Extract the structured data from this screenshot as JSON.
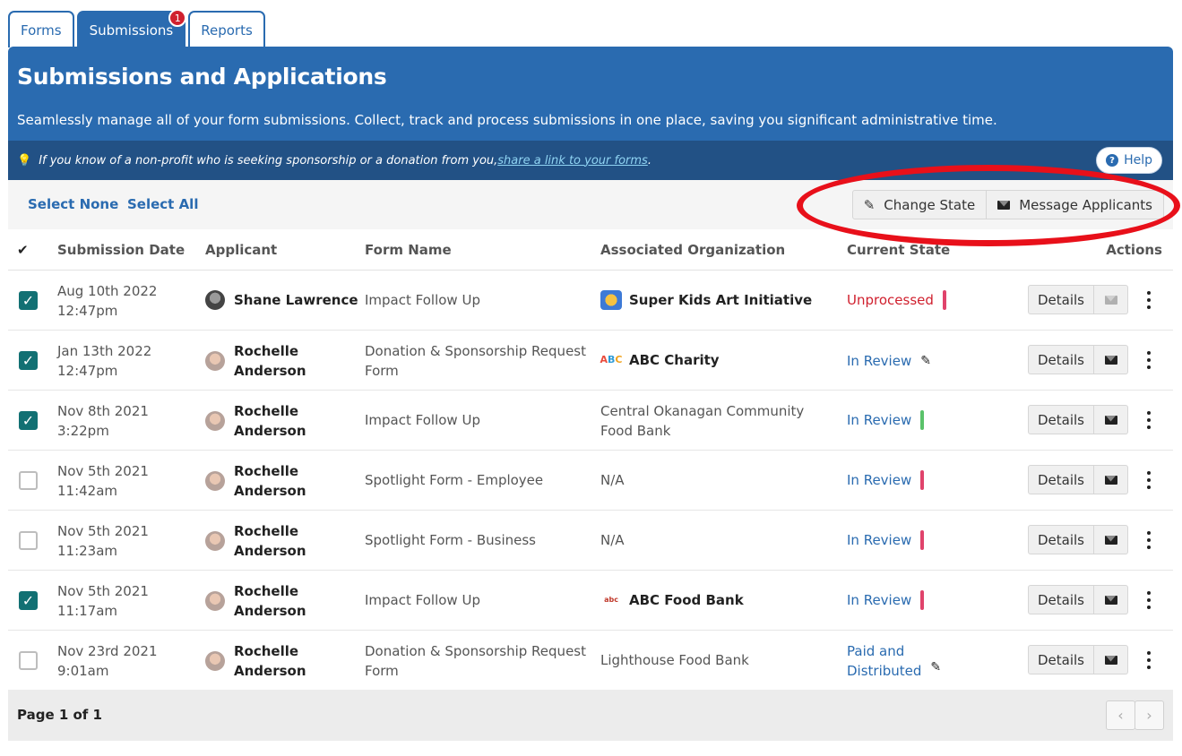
{
  "tabs": [
    {
      "label": "Forms",
      "active": false
    },
    {
      "label": "Submissions",
      "active": true,
      "badge": "1"
    },
    {
      "label": "Reports",
      "active": false
    }
  ],
  "header": {
    "title": "Submissions and Applications",
    "description": "Seamlessly manage all of your form submissions. Collect, track and process submissions in one place, saving you significant administrative time.",
    "tip_text": "If you know of a non-profit who is seeking sponsorship or a donation from you, ",
    "tip_link": "share a link to your forms",
    "tip_end": ".",
    "help_label": "Help"
  },
  "toolbar": {
    "select_none": "Select None",
    "select_all": "Select All",
    "change_state": "Change State",
    "message_applicants": "Message Applicants"
  },
  "table": {
    "headers": {
      "check": "✔",
      "date": "Submission Date",
      "applicant": "Applicant",
      "form": "Form Name",
      "org": "Associated Organization",
      "state": "Current State",
      "actions": "Actions"
    },
    "details_label": "Details",
    "rows": [
      {
        "checked": true,
        "date": "Aug 10th 2022",
        "time": "12:47pm",
        "applicant1": "Shane Lawrence",
        "applicant2": "",
        "form1": "Impact Follow Up",
        "form2": "",
        "org1": "Super Kids Art Initiative",
        "org2": "",
        "state1": "Unprocessed",
        "state2": ""
      },
      {
        "checked": true,
        "date": "Jan 13th 2022",
        "time": "12:47pm",
        "applicant1": "Rochelle",
        "applicant2": "Anderson",
        "form1": "Donation & Sponsorship Request",
        "form2": "Form",
        "org1": "ABC Charity",
        "org2": "",
        "state1": "In Review",
        "state2": ""
      },
      {
        "checked": true,
        "date": "Nov 8th 2021",
        "time": "3:22pm",
        "applicant1": "Rochelle",
        "applicant2": "Anderson",
        "form1": "Impact Follow Up",
        "form2": "",
        "org1": "Central Okanagan Community",
        "org2": "Food Bank",
        "state1": "In Review",
        "state2": ""
      },
      {
        "checked": false,
        "date": "Nov 5th 2021",
        "time": "11:42am",
        "applicant1": "Rochelle",
        "applicant2": "Anderson",
        "form1": "Spotlight Form - Employee",
        "form2": "",
        "org1": "N/A",
        "org2": "",
        "state1": "In Review",
        "state2": ""
      },
      {
        "checked": false,
        "date": "Nov 5th 2021",
        "time": "11:23am",
        "applicant1": "Rochelle",
        "applicant2": "Anderson",
        "form1": "Spotlight Form - Business",
        "form2": "",
        "org1": "N/A",
        "org2": "",
        "state1": "In Review",
        "state2": ""
      },
      {
        "checked": true,
        "date": "Nov 5th 2021",
        "time": "11:17am",
        "applicant1": "Rochelle",
        "applicant2": "Anderson",
        "form1": "Impact Follow Up",
        "form2": "",
        "org1": "ABC Food Bank",
        "org2": "",
        "state1": "In Review",
        "state2": ""
      },
      {
        "checked": false,
        "date": "Nov 23rd 2021",
        "time": "9:01am",
        "applicant1": "Rochelle",
        "applicant2": "Anderson",
        "form1": "Donation & Sponsorship Request",
        "form2": "Form",
        "org1": "Lighthouse Food Bank",
        "org2": "",
        "state1": "Paid and",
        "state2": "Distributed"
      }
    ]
  },
  "footer": {
    "page_info": "Page 1 of 1",
    "prev": "‹",
    "next": "›"
  },
  "colors": {
    "brand_blue": "#2a6bb0",
    "dark_blue": "#225185",
    "unprocessed_red": "#d0202e",
    "check_teal": "#127073",
    "annotation_red": "#e8101a"
  },
  "icons": {
    "bulb": "💡",
    "pencil": "✎",
    "check": "✓"
  }
}
